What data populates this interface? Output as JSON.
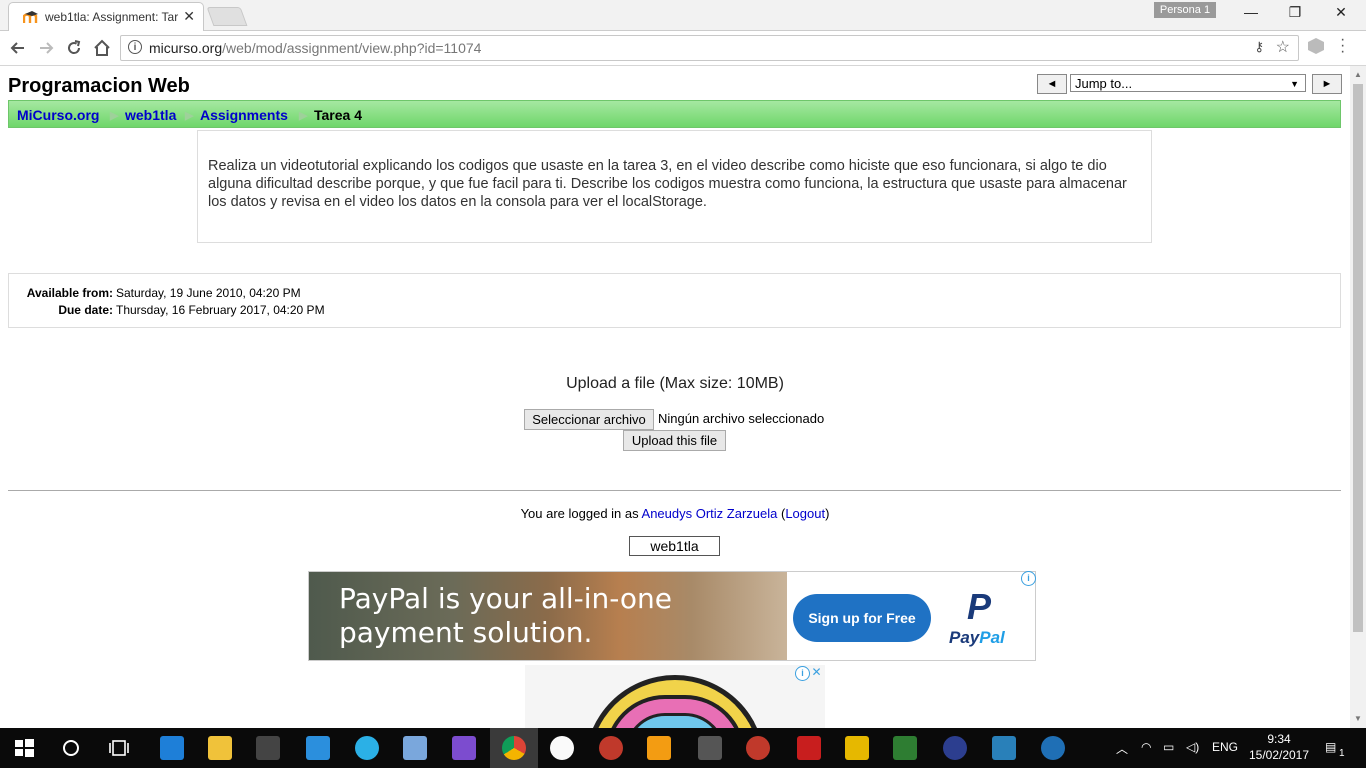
{
  "browser": {
    "tab_title": "web1tla: Assignment: Tar",
    "tab_close": "✕",
    "profile": "Persona 1",
    "url_host": "micurso.org",
    "url_path": "/web/mod/assignment/view.php?id=11074",
    "window_controls": {
      "minimize": "—",
      "restore": "❐",
      "close": "✕"
    }
  },
  "page": {
    "course_title": "Programacion Web",
    "jump": {
      "prev": "◄",
      "next": "►",
      "select_value": "Jump to...",
      "select_arrow": "▼"
    },
    "breadcrumb": [
      {
        "label": "MiCurso.org",
        "link": true
      },
      {
        "label": "web1tla",
        "link": true
      },
      {
        "label": "Assignments",
        "link": true
      },
      {
        "label": "Tarea 4",
        "link": false
      }
    ],
    "breadcrumb_sep": "▶",
    "intro": "Realiza un videotutorial explicando los codigos que usaste en la tarea 3, en el video describe como hiciste que eso funcionara, si algo te dio alguna dificultad describe porque, y que fue facil para ti. Describe los codigos muestra como funciona, la estructura que usaste para almacenar los datos y revisa en el video los datos en la consola para ver el localStorage.",
    "dates": {
      "available_label": "Available from:",
      "available_value": "Saturday, 19 June 2010, 04:20 PM",
      "due_label": "Due date:",
      "due_value": "Thursday, 16 February 2017, 04:20 PM"
    },
    "upload": {
      "title": "Upload a file (Max size: 10MB)",
      "choose_button": "Seleccionar archivo",
      "no_file": "Ningún archivo seleccionado",
      "upload_button": "Upload this file"
    },
    "login": {
      "prefix": "You are logged in as ",
      "user": "Aneudys Ortiz Zarzuela",
      "open_paren": " (",
      "logout": "Logout",
      "close_paren": ")"
    },
    "course_button": "web1tla"
  },
  "ads": {
    "paypal": {
      "headline_line1": "PayPal is your all-in-one",
      "headline_line2": "payment solution.",
      "cta": "Sign up for Free",
      "logo_mark": "P",
      "logo_word_a": "Pay",
      "logo_word_b": "Pal"
    },
    "info_glyph": "i",
    "close_glyph": "✕"
  },
  "taskbar": {
    "language": "ENG",
    "time": "9:34",
    "date": "15/02/2017",
    "notifications": "1"
  }
}
